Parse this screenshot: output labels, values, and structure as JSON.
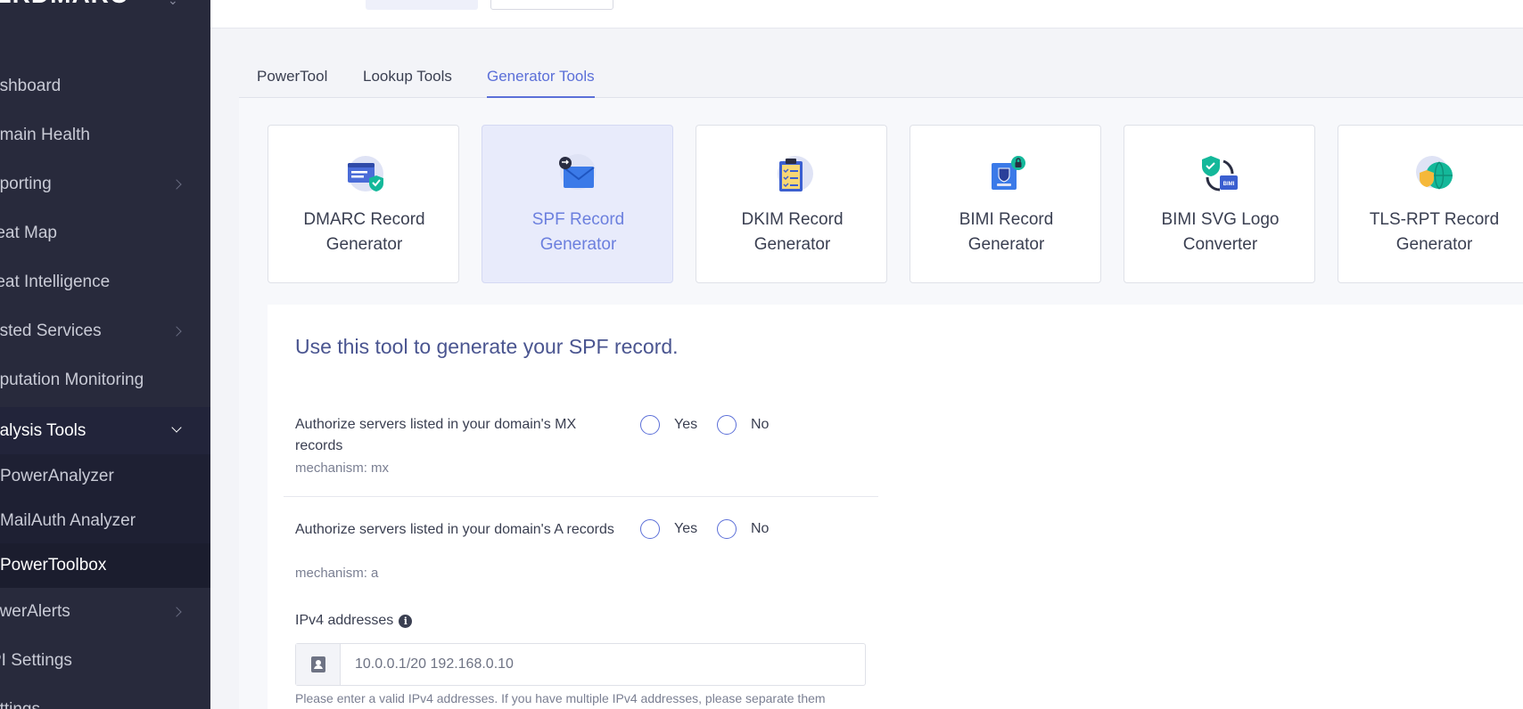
{
  "sidebar": {
    "brand": "ERDMARC",
    "items": [
      {
        "label": "ashboard",
        "chevron": false
      },
      {
        "label": "omain Health",
        "chevron": false
      },
      {
        "label": "eporting",
        "chevron": true
      },
      {
        "label": "reat Map",
        "chevron": false
      },
      {
        "label": "reat Intelligence",
        "chevron": false
      },
      {
        "label": "osted Services",
        "chevron": true
      },
      {
        "label": "eputation Monitoring",
        "chevron": false
      },
      {
        "label": "nalysis Tools",
        "chevron": true,
        "expanded": true
      },
      {
        "label": "owerAlerts",
        "chevron": true
      },
      {
        "label": "PI Settings",
        "chevron": false
      },
      {
        "label": "ettings",
        "chevron": false
      }
    ],
    "subitems": [
      {
        "label": "PowerAnalyzer"
      },
      {
        "label": "MailAuth Analyzer"
      },
      {
        "label": "PowerToolbox",
        "current": true
      }
    ]
  },
  "tabs": [
    {
      "label": "PowerTool"
    },
    {
      "label": "Lookup Tools"
    },
    {
      "label": "Generator Tools",
      "active": true
    }
  ],
  "cards": [
    {
      "line1": "DMARC Record",
      "line2": "Generator",
      "icon": "dmarc-window-shield-icon"
    },
    {
      "line1": "SPF Record",
      "line2": "Generator",
      "icon": "envelope-icon",
      "active": true
    },
    {
      "line1": "DKIM Record",
      "line2": "Generator",
      "icon": "clipboard-checklist-icon"
    },
    {
      "line1": "BIMI Record",
      "line2": "Generator",
      "icon": "bimi-logo-lock-icon"
    },
    {
      "line1": "BIMI SVG Logo",
      "line2": "Converter",
      "icon": "bimi-shield-convert-icon"
    },
    {
      "line1": "TLS-RPT Record",
      "line2": "Generator",
      "icon": "globe-shield-icon"
    }
  ],
  "form": {
    "title": "Use this tool to generate your SPF record.",
    "questions": [
      {
        "label": "Authorize servers listed in your domain's MX records",
        "mechanism": "mechanism: mx",
        "yes": "Yes",
        "no": "No"
      },
      {
        "label": "Authorize servers listed in your domain's A records",
        "mechanism": "mechanism: a",
        "yes": "Yes",
        "no": "No"
      }
    ],
    "ipv4": {
      "label": "IPv4 addresses",
      "placeholder": "10.0.0.1/20 192.168.0.10",
      "help": "Please enter a valid IPv4 addresses. If you have multiple IPv4 addresses, please separate them"
    }
  },
  "colors": {
    "accent": "#5b6fd8",
    "sidebar_bg": "#282a3c",
    "active_card_bg": "#e8ebfb"
  }
}
